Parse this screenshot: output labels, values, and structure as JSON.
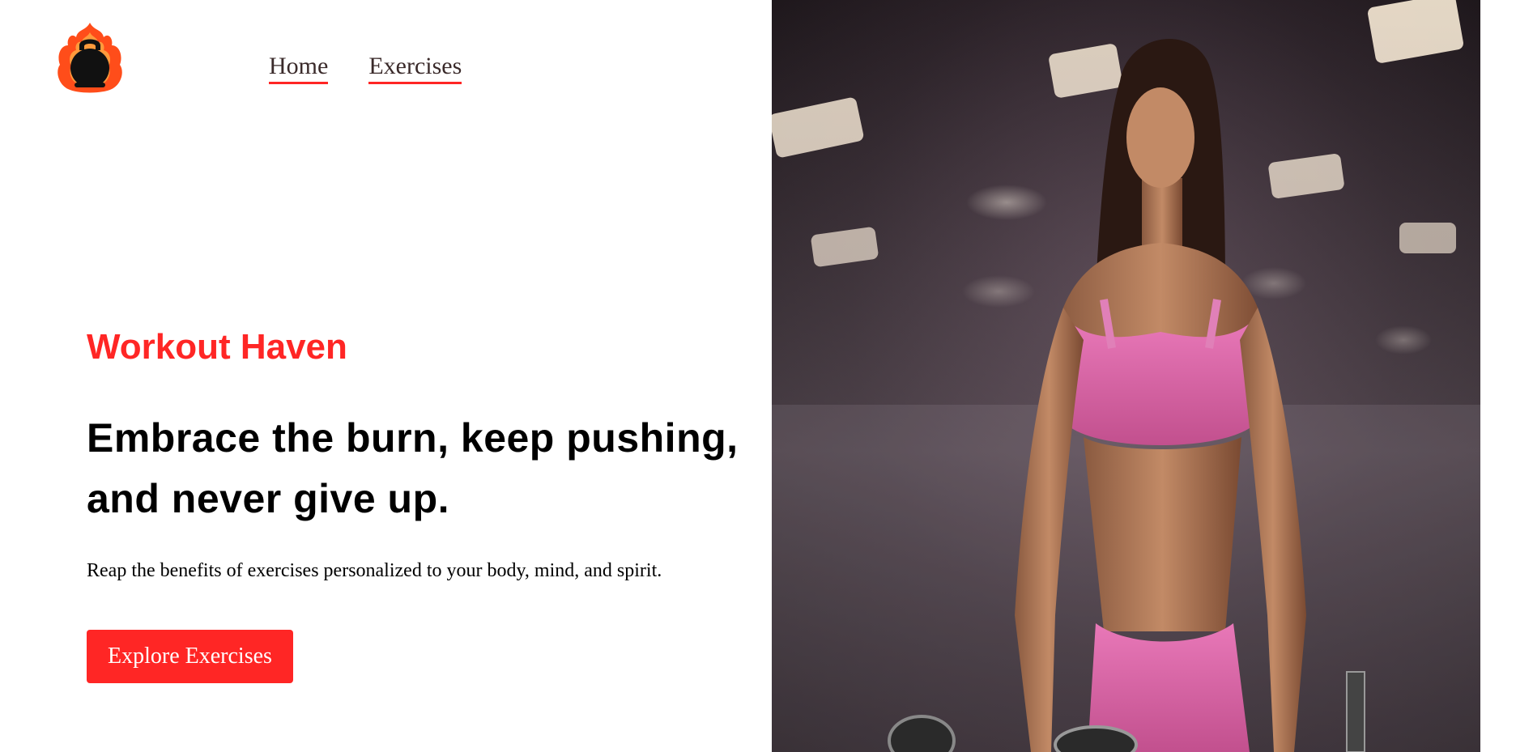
{
  "logo": {
    "icon": "kettlebell-flame-icon",
    "colors": {
      "flame": "#ff4d1a",
      "flame_light": "#ff9a3c",
      "body": "#111111"
    }
  },
  "nav": {
    "items": [
      {
        "label": "Home"
      },
      {
        "label": "Exercises"
      }
    ]
  },
  "hero": {
    "brand": "Workout Haven",
    "headline_line1": "Embrace the burn, keep pushing,",
    "headline_line2": "and never give up.",
    "subtext": "Reap the benefits of exercises personalized to your body, mind, and spirit.",
    "cta_label": "Explore Exercises",
    "image": "woman-athlete-gym-photo"
  },
  "colors": {
    "accent": "#ff2625",
    "text": "#000000",
    "nav_text": "#3a2a2a",
    "background": "#ffffff"
  }
}
